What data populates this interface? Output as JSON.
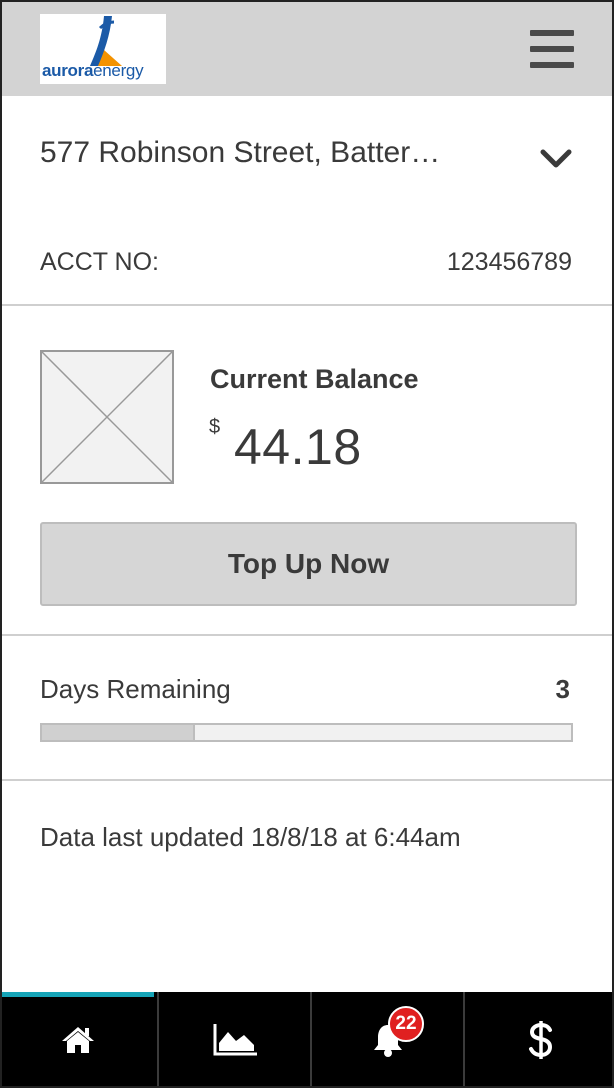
{
  "header": {
    "logo": {
      "brand_bold": "aurora",
      "brand_light": "energy",
      "colors": {
        "blue": "#1b5aa7",
        "orange": "#f39200"
      }
    },
    "menu_icon": "hamburger-menu-icon"
  },
  "account": {
    "address": "577 Robinson Street, Batter…",
    "address_chevron_icon": "chevron-down-icon",
    "acct_label": "ACCT NO:",
    "acct_number": "123456789"
  },
  "balance": {
    "label": "Current Balance",
    "currency": "$",
    "amount": "44.18",
    "image_icon": "image-placeholder-icon",
    "button_label": "Top Up Now"
  },
  "days": {
    "label": "Days Remaining",
    "value": "3",
    "progress_fraction": 0.29
  },
  "status": {
    "updated_text": "Data last updated 18/8/18 at 6:44am"
  },
  "tabbar": {
    "active_color": "#16a4b7",
    "badge_color": "#e02020",
    "tabs": [
      {
        "icon": "home-icon",
        "active": true
      },
      {
        "icon": "area-chart-icon",
        "active": false
      },
      {
        "icon": "bell-icon",
        "active": false,
        "badge": "22"
      },
      {
        "icon": "dollar-icon",
        "active": false
      }
    ]
  }
}
